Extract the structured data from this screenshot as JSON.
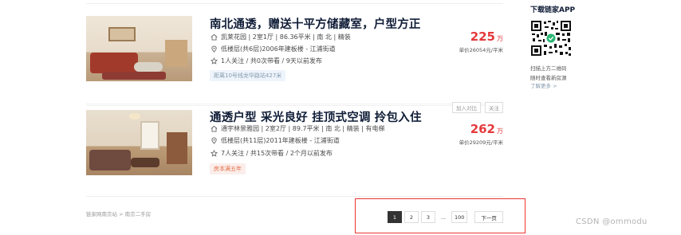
{
  "listings": [
    {
      "title": "南北通透，赠送十平方储藏室，户型方正",
      "community": "凯莱花园 | 2室1厅 | 86.36平米 | 南 北 | 精装",
      "floor": "低楼层(共6层)2006年建板楼 - 江浦街道",
      "follow": "1人关注 / 共0次带看 / 9天以前发布",
      "tag": "距离10号线龙华路站427米",
      "price": "225",
      "price_unit": "万",
      "unit_price": "单价26054元/平米"
    },
    {
      "title": "通透户型  采光良好  挂顶式空调  拎包入住",
      "community": "通宇林景雅园 | 2室2厅 | 89.7平米 | 南 北 | 精装 | 有电梯",
      "floor": "低楼层(共11层)2011年建板楼 - 江浦街道",
      "follow": "7人关注 / 共15次带看 / 2个月以前发布",
      "tag": "房本满五年",
      "price": "262",
      "price_unit": "万",
      "unit_price": "单价29209元/平米",
      "compare_label": "加入对比",
      "follow_label": "关注"
    }
  ],
  "breadcrumb": "链家网南京站  >  南京二手房",
  "pagination": {
    "pages": [
      "1",
      "2",
      "3"
    ],
    "dots": "...",
    "last": "100",
    "next": "下一页",
    "current": 1
  },
  "sidebar": {
    "title": "下载链家APP",
    "line1": "扫描上方二维码",
    "line2": "随时查看新房源",
    "more": "了解更多 >"
  },
  "watermark": "CSDN @ommodu",
  "colors": {
    "price": "#e4393c",
    "title": "#101d37",
    "pager_highlight": "#e33"
  }
}
